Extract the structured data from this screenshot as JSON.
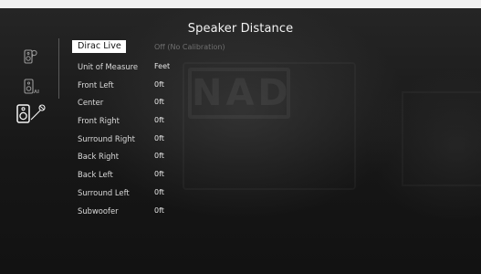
{
  "screen": {
    "title": "Speaker Distance",
    "brand_watermark": "NAD"
  },
  "sidebar": {
    "items": [
      {
        "icon": "speaker-config-icon",
        "selected": false
      },
      {
        "icon": "speaker-levels-icon",
        "selected": false
      },
      {
        "icon": "speaker-distance-icon",
        "selected": true
      }
    ]
  },
  "settings": {
    "rows": [
      {
        "label": "Dirac Live",
        "value": "Off (No Calibration)",
        "selected": true
      },
      {
        "label": "Unit of Measure",
        "value": "Feet"
      },
      {
        "label": "Front Left",
        "value": "0ft"
      },
      {
        "label": "Center",
        "value": "0ft"
      },
      {
        "label": "Front Right",
        "value": "0ft"
      },
      {
        "label": "Surround Right",
        "value": "0ft"
      },
      {
        "label": "Back Right",
        "value": "0ft"
      },
      {
        "label": "Back Left",
        "value": "0ft"
      },
      {
        "label": "Surround Left",
        "value": "0ft"
      },
      {
        "label": "Subwoofer",
        "value": "0ft"
      }
    ]
  },
  "colors": {
    "background": "#1c1c1c",
    "text": "#e6e6e6",
    "selected_bg": "#ffffff",
    "selected_text": "#111111",
    "dim_value": "#6f6f6f"
  }
}
